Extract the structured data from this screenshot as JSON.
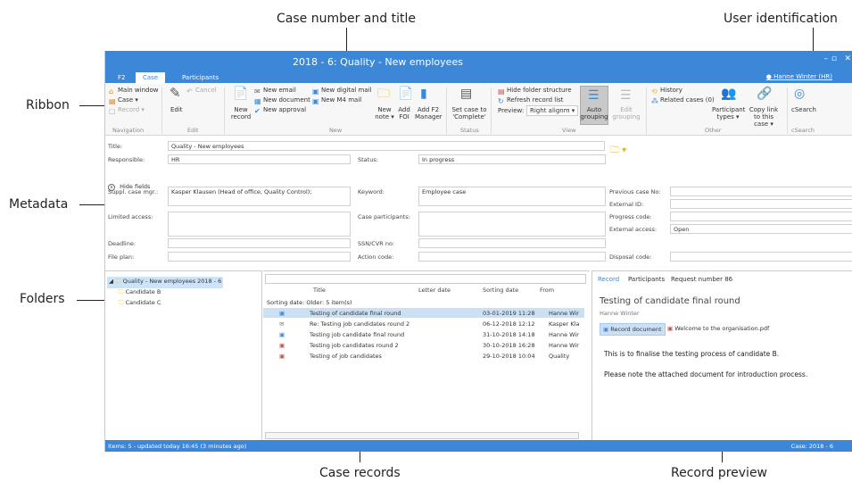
{
  "callouts": {
    "case_number": "Case number and title",
    "user_identification": "User identification",
    "ribbon": "Ribbon",
    "metadata": "Metadata",
    "folders": "Folders",
    "case_records": "Case records",
    "record_preview": "Record preview"
  },
  "window": {
    "title": "2018 - 6: Quality - New employees",
    "tabs": [
      "F2",
      "Case",
      "Participants"
    ],
    "active_tab": "Case",
    "user": "Hanne Winter (HR)",
    "minimize": "–",
    "maximize": "▫",
    "close": "✕"
  },
  "ribbon": {
    "navigation": {
      "title": "Navigation",
      "main_window": "Main window",
      "case": "Case ▾",
      "record": "Record ▾"
    },
    "edit": {
      "title": "Edit",
      "edit": "Edit",
      "cancel": "Cancel"
    },
    "new": {
      "title": "New",
      "new_record": "New record",
      "new_email": "New email",
      "new_document": "New document",
      "new_approval": "New approval",
      "new_digital_mail": "New digital mail",
      "new_m4_mail": "New M4 mail",
      "new_note": "New note ▾",
      "add_foi": "Add FOI",
      "add_f2_manager": "Add F2 Manager"
    },
    "status": {
      "title": "Status",
      "set_case": "Set case to 'Complete'"
    },
    "view": {
      "title": "View",
      "hide_folder": "Hide folder structure",
      "refresh": "Refresh record list",
      "preview_label": "Preview:",
      "preview_value": "Right alignm ▾",
      "auto_grouping": "Auto grouping",
      "edit_grouping": "Edit grouping"
    },
    "other": {
      "title": "Other",
      "history": "History",
      "related": "Related cases (0)",
      "participant_types": "Participant types ▾",
      "copy_link": "Copy link to this case ▾"
    },
    "csearch": {
      "title": "cSearch",
      "label": "cSearch"
    }
  },
  "metadata": {
    "title_label": "Title:",
    "title_value": "Quality - New employees",
    "responsible_label": "Responsible:",
    "responsible_value": "HR",
    "status_label": "Status:",
    "status_value": "In progress",
    "hide_fields": "Hide fields",
    "suppl_label": "Suppl. case mgr.:",
    "suppl_value": "Kasper Klausen (Head of office, Quality Control);",
    "keyword_label": "Keyword:",
    "keyword_value": "Employee case",
    "prev_case_label": "Previous case No:",
    "external_id_label": "External ID:",
    "limited_label": "Limited access:",
    "participants_label": "Case participants:",
    "progress_label": "Progress code:",
    "external_access_label": "External access:",
    "external_access_value": "Open",
    "deadline_label": "Deadline:",
    "ssn_label": "SSN/CVR no:",
    "file_plan_label": "File plan:",
    "action_label": "Action code:",
    "disposal_label": "Disposal code:"
  },
  "folders": {
    "root": "Quality - New employees 2018 - 6",
    "children": [
      "Candidate B",
      "Candidate C"
    ]
  },
  "records": {
    "columns": {
      "title": "Title",
      "letter_date": "Letter date",
      "sorting_date": "Sorting date",
      "from": "From"
    },
    "group": "Sorting date: Older: 5 item(s)",
    "rows": [
      {
        "title": "Testing of candidate final round",
        "date": "03-01-2019 11:28",
        "from": "Hanne Wir"
      },
      {
        "title": "Re: Testing job candidates round 2",
        "date": "06-12-2018 12:12",
        "from": "Kasper Kla"
      },
      {
        "title": "Testing job candidate final round",
        "date": "31-10-2018 14:18",
        "from": "Hanne Wir"
      },
      {
        "title": "Testing job candidates round 2",
        "date": "30-10-2018 16:28",
        "from": "Hanne Wir"
      },
      {
        "title": "Testing of job candidates",
        "date": "29-10-2018 10:04",
        "from": "Quality"
      }
    ]
  },
  "preview": {
    "tabs": [
      "Record",
      "Participants",
      "Request number 86"
    ],
    "title": "Testing of candidate final round",
    "author": "Hanne Winter",
    "doc_tab": "Record document",
    "attachment": "Welcome to the organisation.pdf",
    "line1": "This is to finalise the testing process of candidate B.",
    "line2": "Please note the attached document for introduction process."
  },
  "statusbar": {
    "left": "Items: 5 - updated today 16:45 (3 minutes ago)",
    "right": "Case: 2018 - 6"
  },
  "colors": {
    "accent": "#3c87d8",
    "selected_row": "#cce0f5"
  }
}
